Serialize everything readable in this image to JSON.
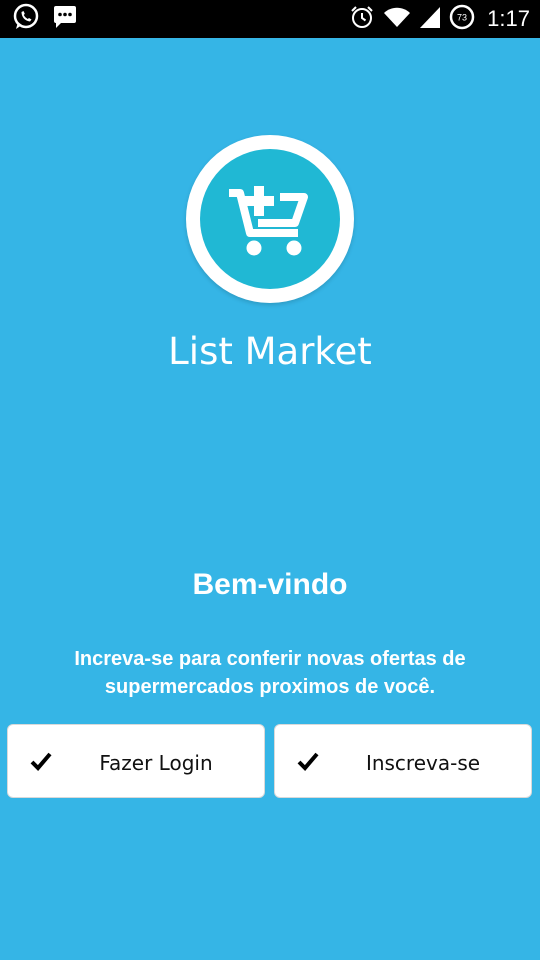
{
  "status_bar": {
    "time": "1:17",
    "battery_level": "73",
    "icons": [
      "whatsapp-icon",
      "sms-icon",
      "alarm-icon",
      "wifi-icon",
      "signal-icon",
      "battery-icon"
    ]
  },
  "app": {
    "title": "List Market",
    "logo_icon": "cart-plus-icon"
  },
  "welcome": {
    "heading": "Bem-vindo",
    "subtitle": "Increva-se para conferir novas ofertas de supermercados proximos de você."
  },
  "buttons": {
    "login_label": "Fazer Login",
    "signup_label": "Inscreva-se"
  },
  "colors": {
    "background": "#35b5e6",
    "logo_circle": "#20b8d4",
    "status_bar": "#000000"
  }
}
